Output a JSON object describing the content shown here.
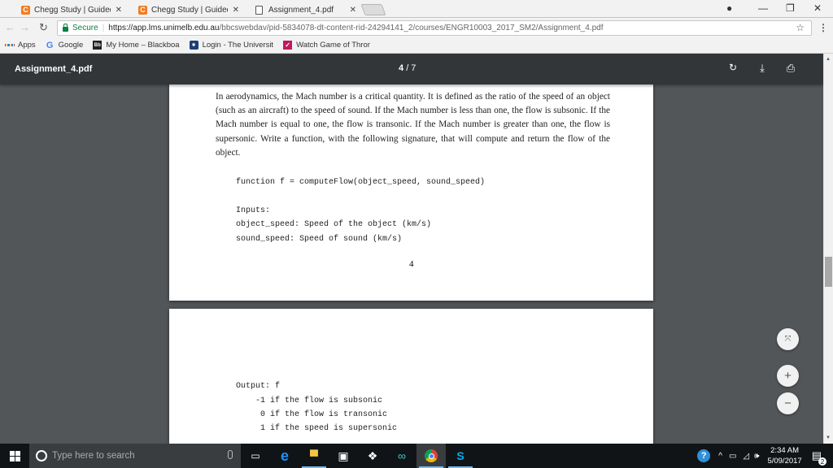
{
  "browser": {
    "tabs": [
      {
        "title": "Chegg Study | Guided So",
        "favicon": "chegg-icon",
        "active": false
      },
      {
        "title": "Chegg Study | Guided So",
        "favicon": "chegg-icon",
        "active": false
      },
      {
        "title": "Assignment_4.pdf",
        "favicon": "document-icon",
        "active": true
      }
    ],
    "close_glyph": "✕",
    "secure_label": "Secure",
    "url_host": "https://app.lms.unimelb.edu.au",
    "url_path": "/bbcswebdav/pid-5834078-dt-content-rid-24294141_2/courses/ENGR10003_2017_SM2/Assignment_4.pdf",
    "bookmarks": [
      {
        "label": "Apps",
        "icon": "apps-grid-icon"
      },
      {
        "label": "Google",
        "icon": "google-icon"
      },
      {
        "label": "My Home – Blackboa",
        "icon": "blackboard-icon"
      },
      {
        "label": "Login - The Universit",
        "icon": "unimelb-icon"
      },
      {
        "label": "Watch Game of Thror",
        "icon": "bookmark-site-icon"
      }
    ]
  },
  "pdf": {
    "filename": "Assignment_4.pdf",
    "current_page": "4",
    "page_sep": "/ 7",
    "page4": {
      "paragraph": "In aerodynamics, the Mach number is a critical quantity. It is defined as the ratio of the speed of an object (such as an aircraft) to the speed of sound. If the Mach number is less than one, the flow is subsonic. If the Mach number is equal to one, the flow is transonic. If the Mach number is greater than one, the flow is supersonic. Write a function, with the following signature, that will compute and return the flow of the object.",
      "signature": "function f = computeFlow(object_speed, sound_speed)",
      "inputs_heading": "Inputs:",
      "inputs": [
        "object_speed: Speed of the object (km/s)",
        "sound_speed: Speed of sound (km/s)"
      ],
      "page_number": "4"
    },
    "page5": {
      "output_heading": "Output: f",
      "outputs": [
        "-1 if the flow is subsonic",
        " 0 if the flow is transonic",
        " 1 if the speed is supersonic"
      ]
    }
  },
  "taskbar": {
    "search_placeholder": "Type here to search",
    "time": "2:34 AM",
    "date": "5/09/2017",
    "notifications": "2"
  }
}
